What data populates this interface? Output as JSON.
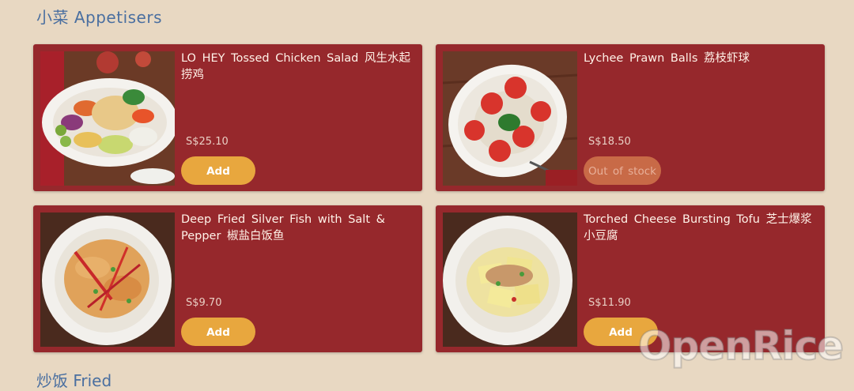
{
  "section": {
    "title": "小菜  Appetisers",
    "next_title": "炒饭 Fried"
  },
  "items": [
    {
      "name": "LO HEY Tossed Chicken Salad 风生水起捞鸡",
      "price": "S$25.10",
      "button": "Add",
      "available": true
    },
    {
      "name": "Lychee Prawn Balls 荔枝虾球",
      "price": "S$18.50",
      "button": "Out of stock",
      "available": false
    },
    {
      "name": "Deep Fried Silver Fish with Salt & Pepper 椒盐白饭鱼",
      "price": "S$9.70",
      "button": "Add",
      "available": true
    },
    {
      "name": "Torched Cheese Bursting Tofu 芝士爆浆小豆腐",
      "price": "S$11.90",
      "button": "Add",
      "available": true
    }
  ],
  "colors": {
    "page_bg": "#e8d8c2",
    "card_bg": "#96282c",
    "add_button": "#e8a73e",
    "out_of_stock_button": "#c86a47",
    "section_title": "#4a6fa0"
  },
  "watermark": "OpenRice"
}
